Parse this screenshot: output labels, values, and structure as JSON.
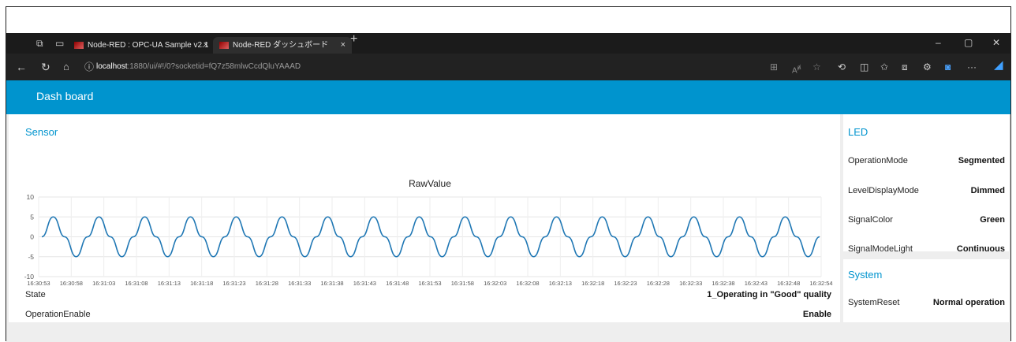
{
  "browser": {
    "tabs": [
      {
        "label": "Node-RED : OPC-UA Sample v2.1",
        "close": "×"
      },
      {
        "label": "Node-RED ダッシュボード",
        "close": "×"
      }
    ],
    "new_tab": "+",
    "url_host": "localhost",
    "url_rest": ":1880/ui/#!/0?socketid=fQ7z58mlwCcdQluYAAAD",
    "window_controls": [
      "–",
      "▢",
      "✕"
    ],
    "icons": [
      "tab-actions-icon",
      "workspaces-icon",
      "back-icon",
      "refresh-icon",
      "home-icon",
      "info-icon",
      "read-aloud-icon",
      "favorite-icon",
      "split-screen-icon",
      "collections-icon",
      "extensions-icon",
      "more-icon"
    ]
  },
  "dashboard": {
    "title": "Dash board"
  },
  "sensor": {
    "title": "Sensor",
    "rows": [
      {
        "label": "State",
        "value": "1_Operating in \"Good\" quality"
      },
      {
        "label": "OperationEnable",
        "value": "Enable"
      }
    ]
  },
  "led": {
    "title": "LED",
    "rows": [
      {
        "label": "OperationMode",
        "value": "Segmented"
      },
      {
        "label": "LevelDisplayMode",
        "value": "Dimmed"
      },
      {
        "label": "SignalColor",
        "value": "Green"
      },
      {
        "label": "SignalModeLight",
        "value": "Continuous"
      }
    ]
  },
  "system": {
    "title": "System",
    "rows": [
      {
        "label": "SystemReset",
        "value": "Normal operation"
      }
    ]
  },
  "chart_data": {
    "type": "line",
    "title": "RawValue",
    "xlabel": "",
    "ylabel": "",
    "ylim": [
      -10,
      10
    ],
    "yticks": [
      "10",
      "5",
      "0",
      "-5",
      "-10"
    ],
    "x": [
      "16:30:53",
      "16:30:58",
      "16:31:03",
      "16:31:08",
      "16:31:13",
      "16:31:18",
      "16:31:23",
      "16:31:28",
      "16:31:33",
      "16:31:38",
      "16:31:43",
      "16:31:48",
      "16:31:53",
      "16:31:58",
      "16:32:03",
      "16:32:08",
      "16:32:13",
      "16:32:18",
      "16:32:23",
      "16:32:28",
      "16:32:33",
      "16:32:38",
      "16:32:43",
      "16:32:48",
      "16:32:54"
    ],
    "series": [
      {
        "color": "#1f77b4",
        "values": [
          0,
          5,
          0,
          -5,
          0,
          5,
          0,
          -5,
          0,
          5,
          0,
          -5,
          0,
          5,
          0,
          -5,
          0,
          5,
          0,
          -5,
          0,
          5,
          0,
          -5,
          0,
          5,
          0,
          -5,
          0,
          5,
          0,
          -5,
          0,
          5,
          0,
          -5,
          0,
          5,
          0,
          -5,
          0,
          5,
          0,
          -5,
          0,
          5,
          0,
          -5,
          0,
          5,
          0,
          -5,
          0,
          5,
          0,
          -5,
          0,
          5,
          0,
          -5,
          0,
          5,
          0,
          -5,
          0,
          5,
          0,
          -5,
          0
        ],
        "x_end": "16:32:54"
      }
    ],
    "grid": true,
    "legend": "none"
  },
  "colors": {
    "accent": "#0094ce",
    "line": "#1f77b4"
  }
}
